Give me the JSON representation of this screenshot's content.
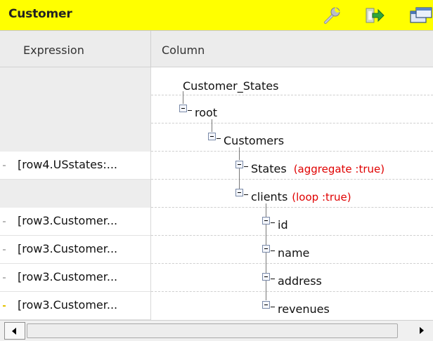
{
  "panel": {
    "title": "Customer"
  },
  "toolbar": {
    "icons": [
      "wrench-icon",
      "import-arrow-icon",
      "window-icon"
    ]
  },
  "columns": {
    "expression": "Expression",
    "column": "Column"
  },
  "expressions": [
    "",
    "",
    "",
    "[row4.USstates:...",
    "",
    "[row3.Customer...",
    "[row3.Customer...",
    "[row3.Customer...",
    "[row3.Customer..."
  ],
  "tree": {
    "root_label": "Customer_States",
    "root": "root",
    "customers": "Customers",
    "states": "States",
    "states_attr": "(aggregate :true)",
    "clients": "clients",
    "clients_attr": "(loop :true)",
    "id": "id",
    "name": "name",
    "address": "address",
    "revenues": "revenues"
  },
  "colors": {
    "title_bar": "#ffff00",
    "attribute_text": "#e00000"
  }
}
